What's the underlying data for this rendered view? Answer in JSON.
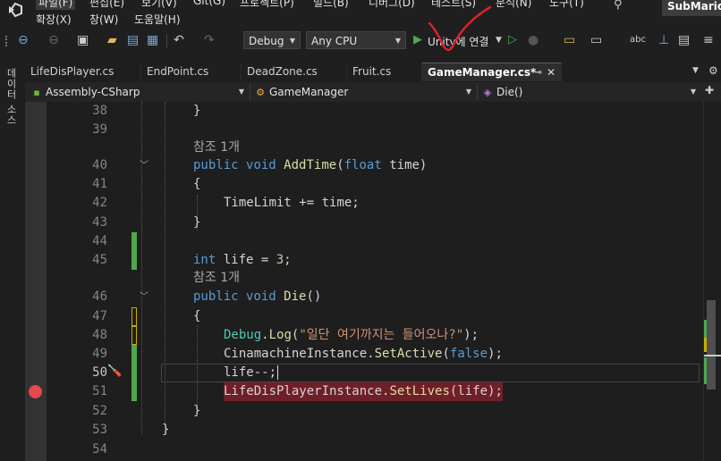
{
  "menubar": {
    "row1": [
      "파일(F)",
      "편집(E)",
      "보기(V)",
      "Git(G)",
      "프로젝트(P)",
      "빌드(B)",
      "디버그(D)",
      "테스트(S)",
      "분석(N)",
      "도구(T)"
    ],
    "row2": [
      "확장(X)",
      "창(W)",
      "도움말(H)"
    ],
    "project_name": "SubMario"
  },
  "toolbar": {
    "configuration": "Debug",
    "platform": "Any CPU",
    "run_target": "Unity에 연결"
  },
  "sidebar": {
    "label": "데이터 소스"
  },
  "tabs": [
    {
      "label": "LifeDisPlayer.cs",
      "active": false
    },
    {
      "label": "EndPoint.cs",
      "active": false
    },
    {
      "label": "DeadZone.cs",
      "active": false
    },
    {
      "label": "Fruit.cs",
      "active": false
    },
    {
      "label": "GameManager.cs*",
      "active": true
    }
  ],
  "navbar": {
    "project": "Assembly-CSharp",
    "class": "GameManager",
    "member": "Die()"
  },
  "colors": {
    "keyword": "#569cd6",
    "method": "#dcdcaa",
    "class": "#4ec9b0",
    "string": "#ce9178",
    "breakpoint": "#e5484d",
    "change_saved": "#4ea84e",
    "change_unsaved": "#c4b000"
  },
  "code_lines": [
    {
      "n": "38",
      "text": "    }"
    },
    {
      "n": "39",
      "text": ""
    },
    {
      "n": "",
      "text": "참조 1개",
      "codelens": true
    },
    {
      "n": "40",
      "text": "public void AddTime(float time)"
    },
    {
      "n": "41",
      "text": "{"
    },
    {
      "n": "42",
      "text": "    TimeLimit += time;"
    },
    {
      "n": "43",
      "text": "}"
    },
    {
      "n": "44",
      "text": ""
    },
    {
      "n": "45",
      "text": "int life = 3;"
    },
    {
      "n": "",
      "text": "참조 1개",
      "codelens": true
    },
    {
      "n": "46",
      "text": "public void Die()"
    },
    {
      "n": "47",
      "text": "{"
    },
    {
      "n": "48",
      "text": "    Debug.Log(\"일단 여기까지는 들어오나?\");"
    },
    {
      "n": "49",
      "text": "    CinamachineInstance.SetActive(false);"
    },
    {
      "n": "50",
      "text": "    life--;"
    },
    {
      "n": "51",
      "text": "    LifeDisPlayerInstance.SetLives(life);"
    },
    {
      "n": "52",
      "text": "}"
    },
    {
      "n": "53",
      "text": "}"
    },
    {
      "n": "54",
      "text": ""
    }
  ]
}
